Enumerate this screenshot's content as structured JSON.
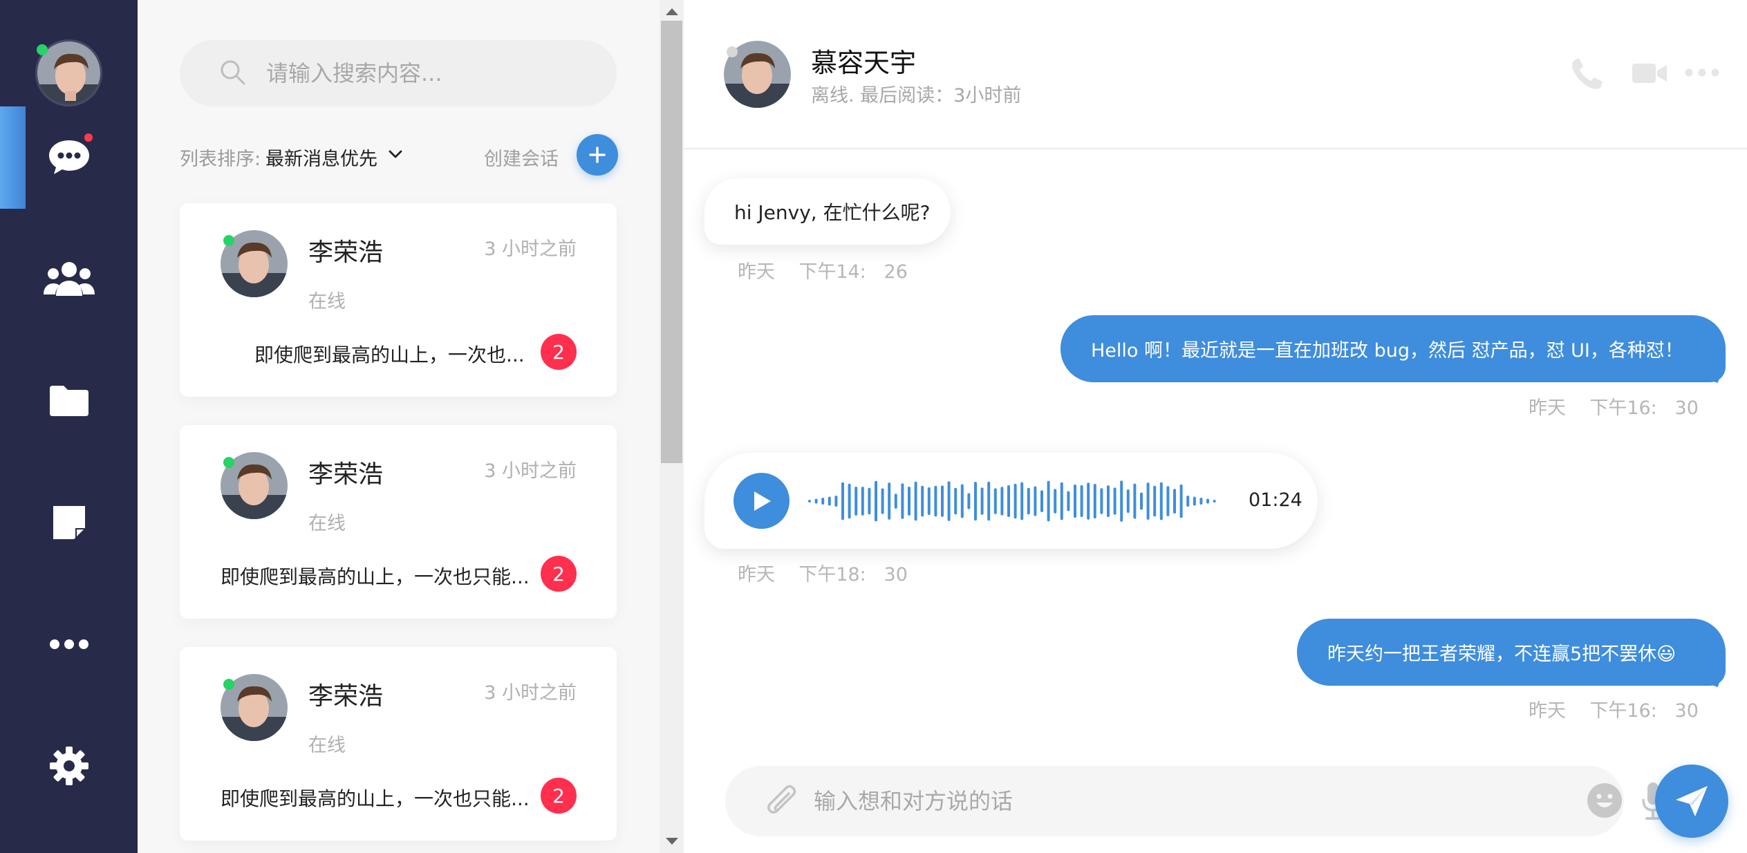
{
  "nav": {
    "items": [
      {
        "name": "chat-icon"
      },
      {
        "name": "contacts-icon"
      },
      {
        "name": "folder-icon"
      },
      {
        "name": "note-icon"
      },
      {
        "name": "more-icon"
      },
      {
        "name": "gear-icon"
      }
    ],
    "active_item": "chat-icon"
  },
  "list": {
    "search_placeholder": "请输入搜索内容...",
    "sort_label": "列表排序:",
    "sort_value": "最新消息优先",
    "create_label": "创建会话",
    "conversations": [
      {
        "name": "李荣浩",
        "time": "3 小时之前",
        "presence": "在线",
        "preview": "即使爬到最高的山上，一次也...",
        "unread": "2"
      },
      {
        "name": "李荣浩",
        "time": "3 小时之前",
        "presence": "在线",
        "preview": "即使爬到最高的山上，一次也只能...",
        "unread": "2"
      },
      {
        "name": "李荣浩",
        "time": "3 小时之前",
        "presence": "在线",
        "preview": "即使爬到最高的山上，一次也只能...",
        "unread": "2"
      }
    ]
  },
  "chat": {
    "contact_name": "慕容天宇",
    "contact_status": "离线. 最后阅读：3小时前",
    "messages": [
      {
        "direction": "in",
        "type": "text",
        "text": "hi Jenvy, 在忙什么呢?",
        "time": "昨天    下午14:   26"
      },
      {
        "direction": "out",
        "type": "text",
        "text": "Hello 啊！最近就是一直在加班改 bug，然后 怼产品，怼 UI，各种怼！",
        "time": "昨天    下午16:   30"
      },
      {
        "direction": "in",
        "type": "voice",
        "duration": "01:24",
        "time": "昨天    下午18:   30"
      },
      {
        "direction": "out",
        "type": "text",
        "text": "昨天约一把王者荣耀，不连赢5把不罢休😃",
        "time": "昨天    下午16:   30"
      }
    ],
    "composer_placeholder": "输入想和对方说的话"
  },
  "colors": {
    "nav_bg": "#282a4a",
    "accent": "#3f8ddd",
    "badge": "#ff2f4d",
    "online": "#25d366"
  }
}
